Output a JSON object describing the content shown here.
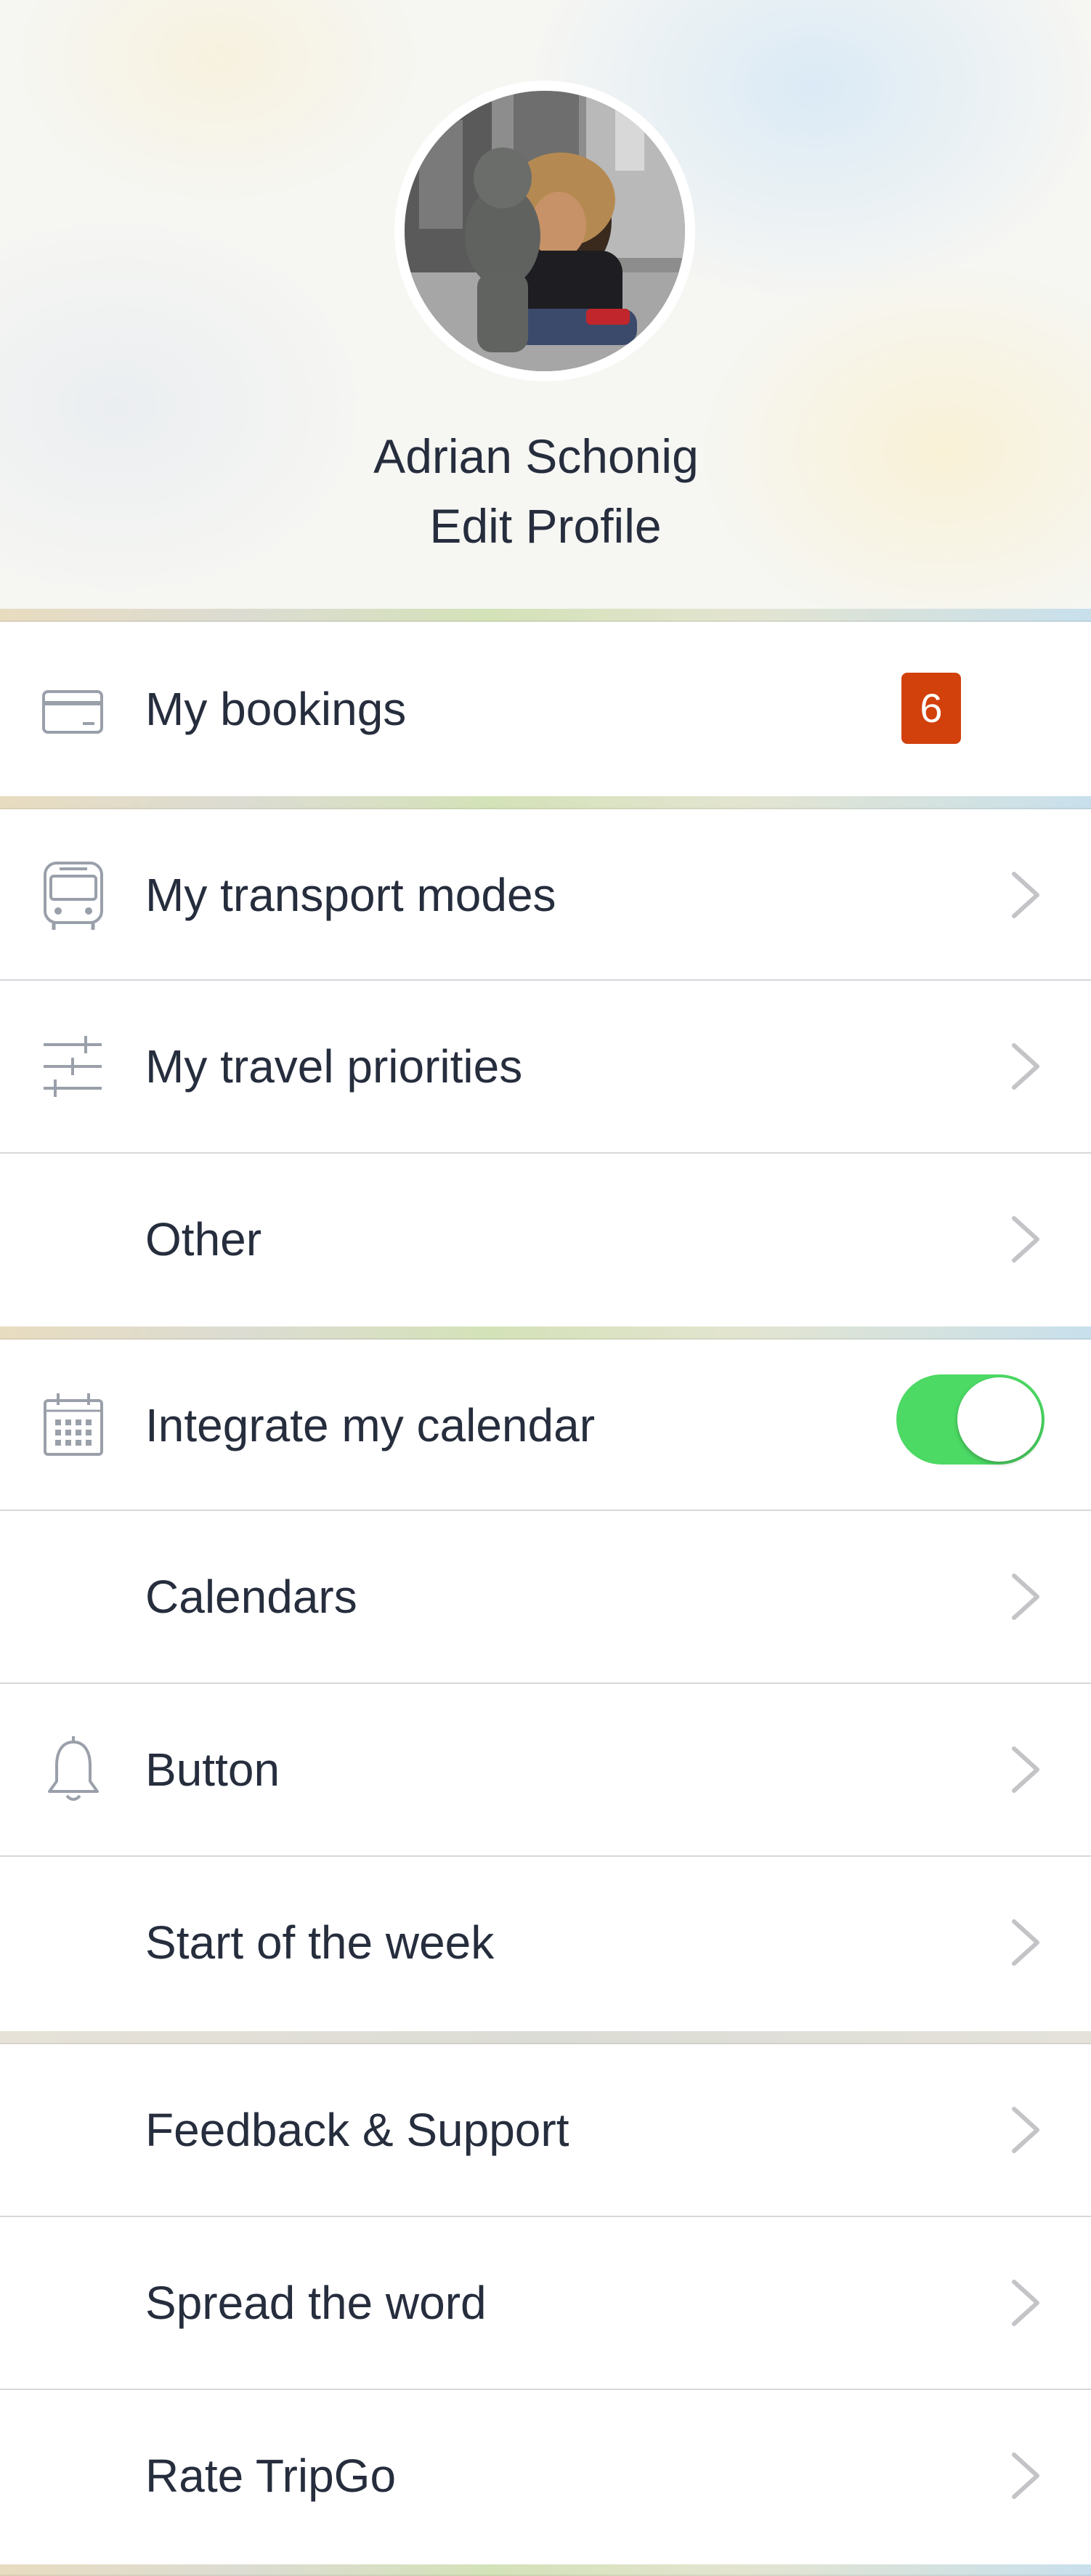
{
  "profile": {
    "name": "Adrian Schonig",
    "edit_label": "Edit Profile",
    "avatar_alt": "profile-photo"
  },
  "bookings": {
    "label": "My bookings",
    "badge_count": "6",
    "badge_color": "#d2400c",
    "icon": "credit-card-icon"
  },
  "menu_primary": [
    {
      "label": "My transport modes",
      "icon": "bus-icon"
    },
    {
      "label": "My travel priorities",
      "icon": "sliders-icon"
    },
    {
      "label": "Other",
      "icon": ""
    }
  ],
  "calendar": {
    "integrate_label": "Integrate my calendar",
    "integrate_on": true,
    "toggle_color": "#4cd964",
    "icon": "calendar-icon",
    "items": [
      {
        "label": "Calendars",
        "icon": ""
      },
      {
        "label": "Button",
        "icon": "bell-icon"
      },
      {
        "label": "Start of the week",
        "icon": ""
      }
    ]
  },
  "menu_support": [
    {
      "label": "Feedback & Support"
    },
    {
      "label": "Spread the word"
    },
    {
      "label": "Rate TripGo"
    }
  ],
  "colors": {
    "text": "#262d3d",
    "icon": "#9aa0aa",
    "chevron": "#c4c4c8",
    "divider": "#d7d7dc"
  }
}
